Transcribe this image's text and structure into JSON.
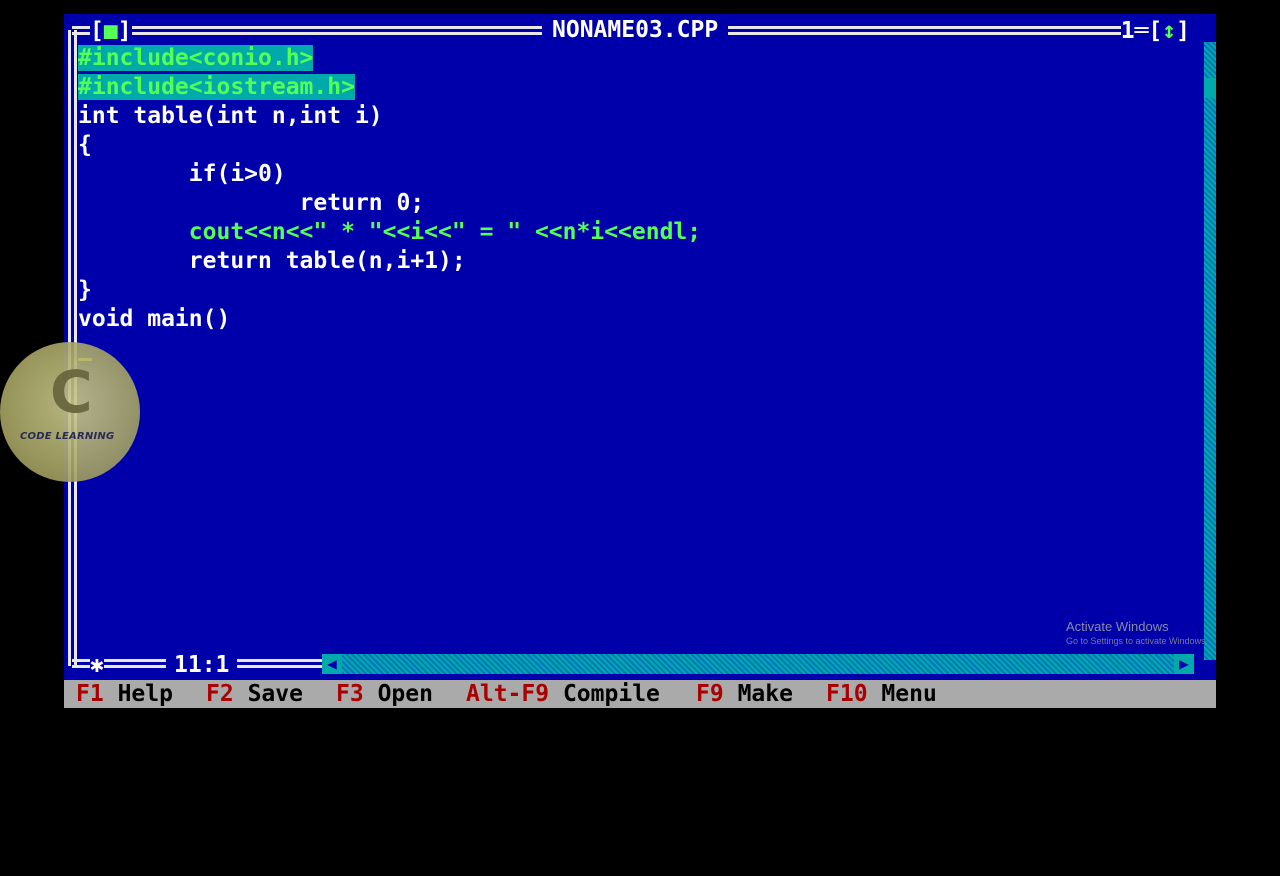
{
  "window": {
    "title": "NONAME03.CPP",
    "close_box": "[■]",
    "window_number": "1",
    "zoom_box": "[↕]",
    "cursor_position": "11:1"
  },
  "code": {
    "lines": [
      "#include<conio.h>",
      "#include<iostream.h>",
      "int table(int n,int i)",
      "{",
      "        if(i>0)",
      "                return 0;",
      "        cout<<n<<\" * \"<<i<<\" = \" <<n*i<<endl;",
      "        return table(n,i+1);",
      "}",
      "void main()",
      ""
    ]
  },
  "watermark": {
    "text": "CODE LEARNING"
  },
  "system_notice": {
    "line1": "Activate Windows",
    "line2": "Go to Settings to activate Windows."
  },
  "menu": {
    "items": [
      {
        "key": "F1",
        "label": "Help"
      },
      {
        "key": "F2",
        "label": "Save"
      },
      {
        "key": "F3",
        "label": "Open"
      },
      {
        "key": "Alt-F9",
        "label": "Compile"
      },
      {
        "key": "F9",
        "label": "Make"
      },
      {
        "key": "F10",
        "label": "Menu"
      }
    ]
  },
  "colors": {
    "editor_bg": "#0000aa",
    "frame": "#e8e8e8",
    "identifier": "#55ff55",
    "string": "#ff5555",
    "number": "#aaaaaa",
    "menu_bg": "#aaaaaa",
    "menu_key": "#aa0000"
  }
}
